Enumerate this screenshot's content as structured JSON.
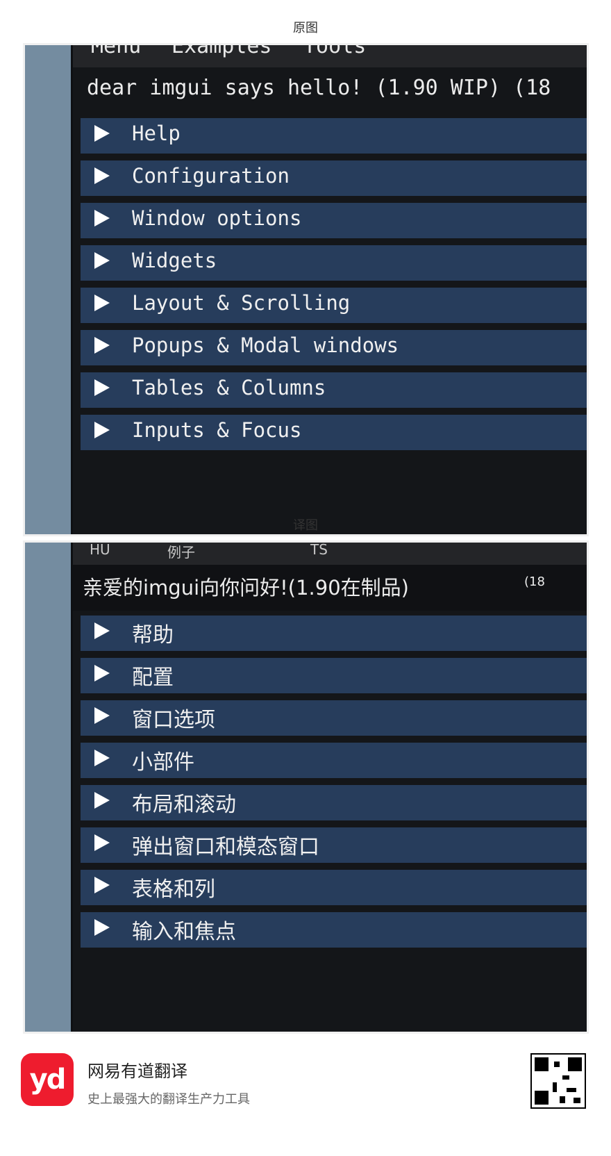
{
  "captions": {
    "original": "原图",
    "translated": "译图"
  },
  "original": {
    "menubar": {
      "menu": "Menu",
      "examples": "Examples",
      "tools": "Tools"
    },
    "title": "dear imgui says hello! (1.90 WIP) (18",
    "headers": [
      "Help",
      "Configuration",
      "Window options",
      "Widgets",
      "Layout & Scrolling",
      "Popups & Modal windows",
      "Tables & Columns",
      "Inputs & Focus"
    ]
  },
  "translated": {
    "menubar": {
      "menu": "HU",
      "examples": "例子",
      "tools": "TS"
    },
    "title": "亲爱的imgui向你问好!(1.90在制品)",
    "title_right": "(18",
    "headers": [
      "帮助",
      "配置",
      "窗口选项",
      "小部件",
      "布局和滚动",
      "弹出窗口和模态窗口",
      "表格和列",
      "输入和焦点"
    ]
  },
  "footer": {
    "logo": "yd",
    "brand": "网易有道翻译",
    "slogan": "史上最强大的翻译生产力工具"
  },
  "colors": {
    "header_bg": "#273d5c",
    "window_bg": "#141619",
    "sidebar_bg": "#748ca0",
    "logo_red": "#ee1c2e"
  }
}
